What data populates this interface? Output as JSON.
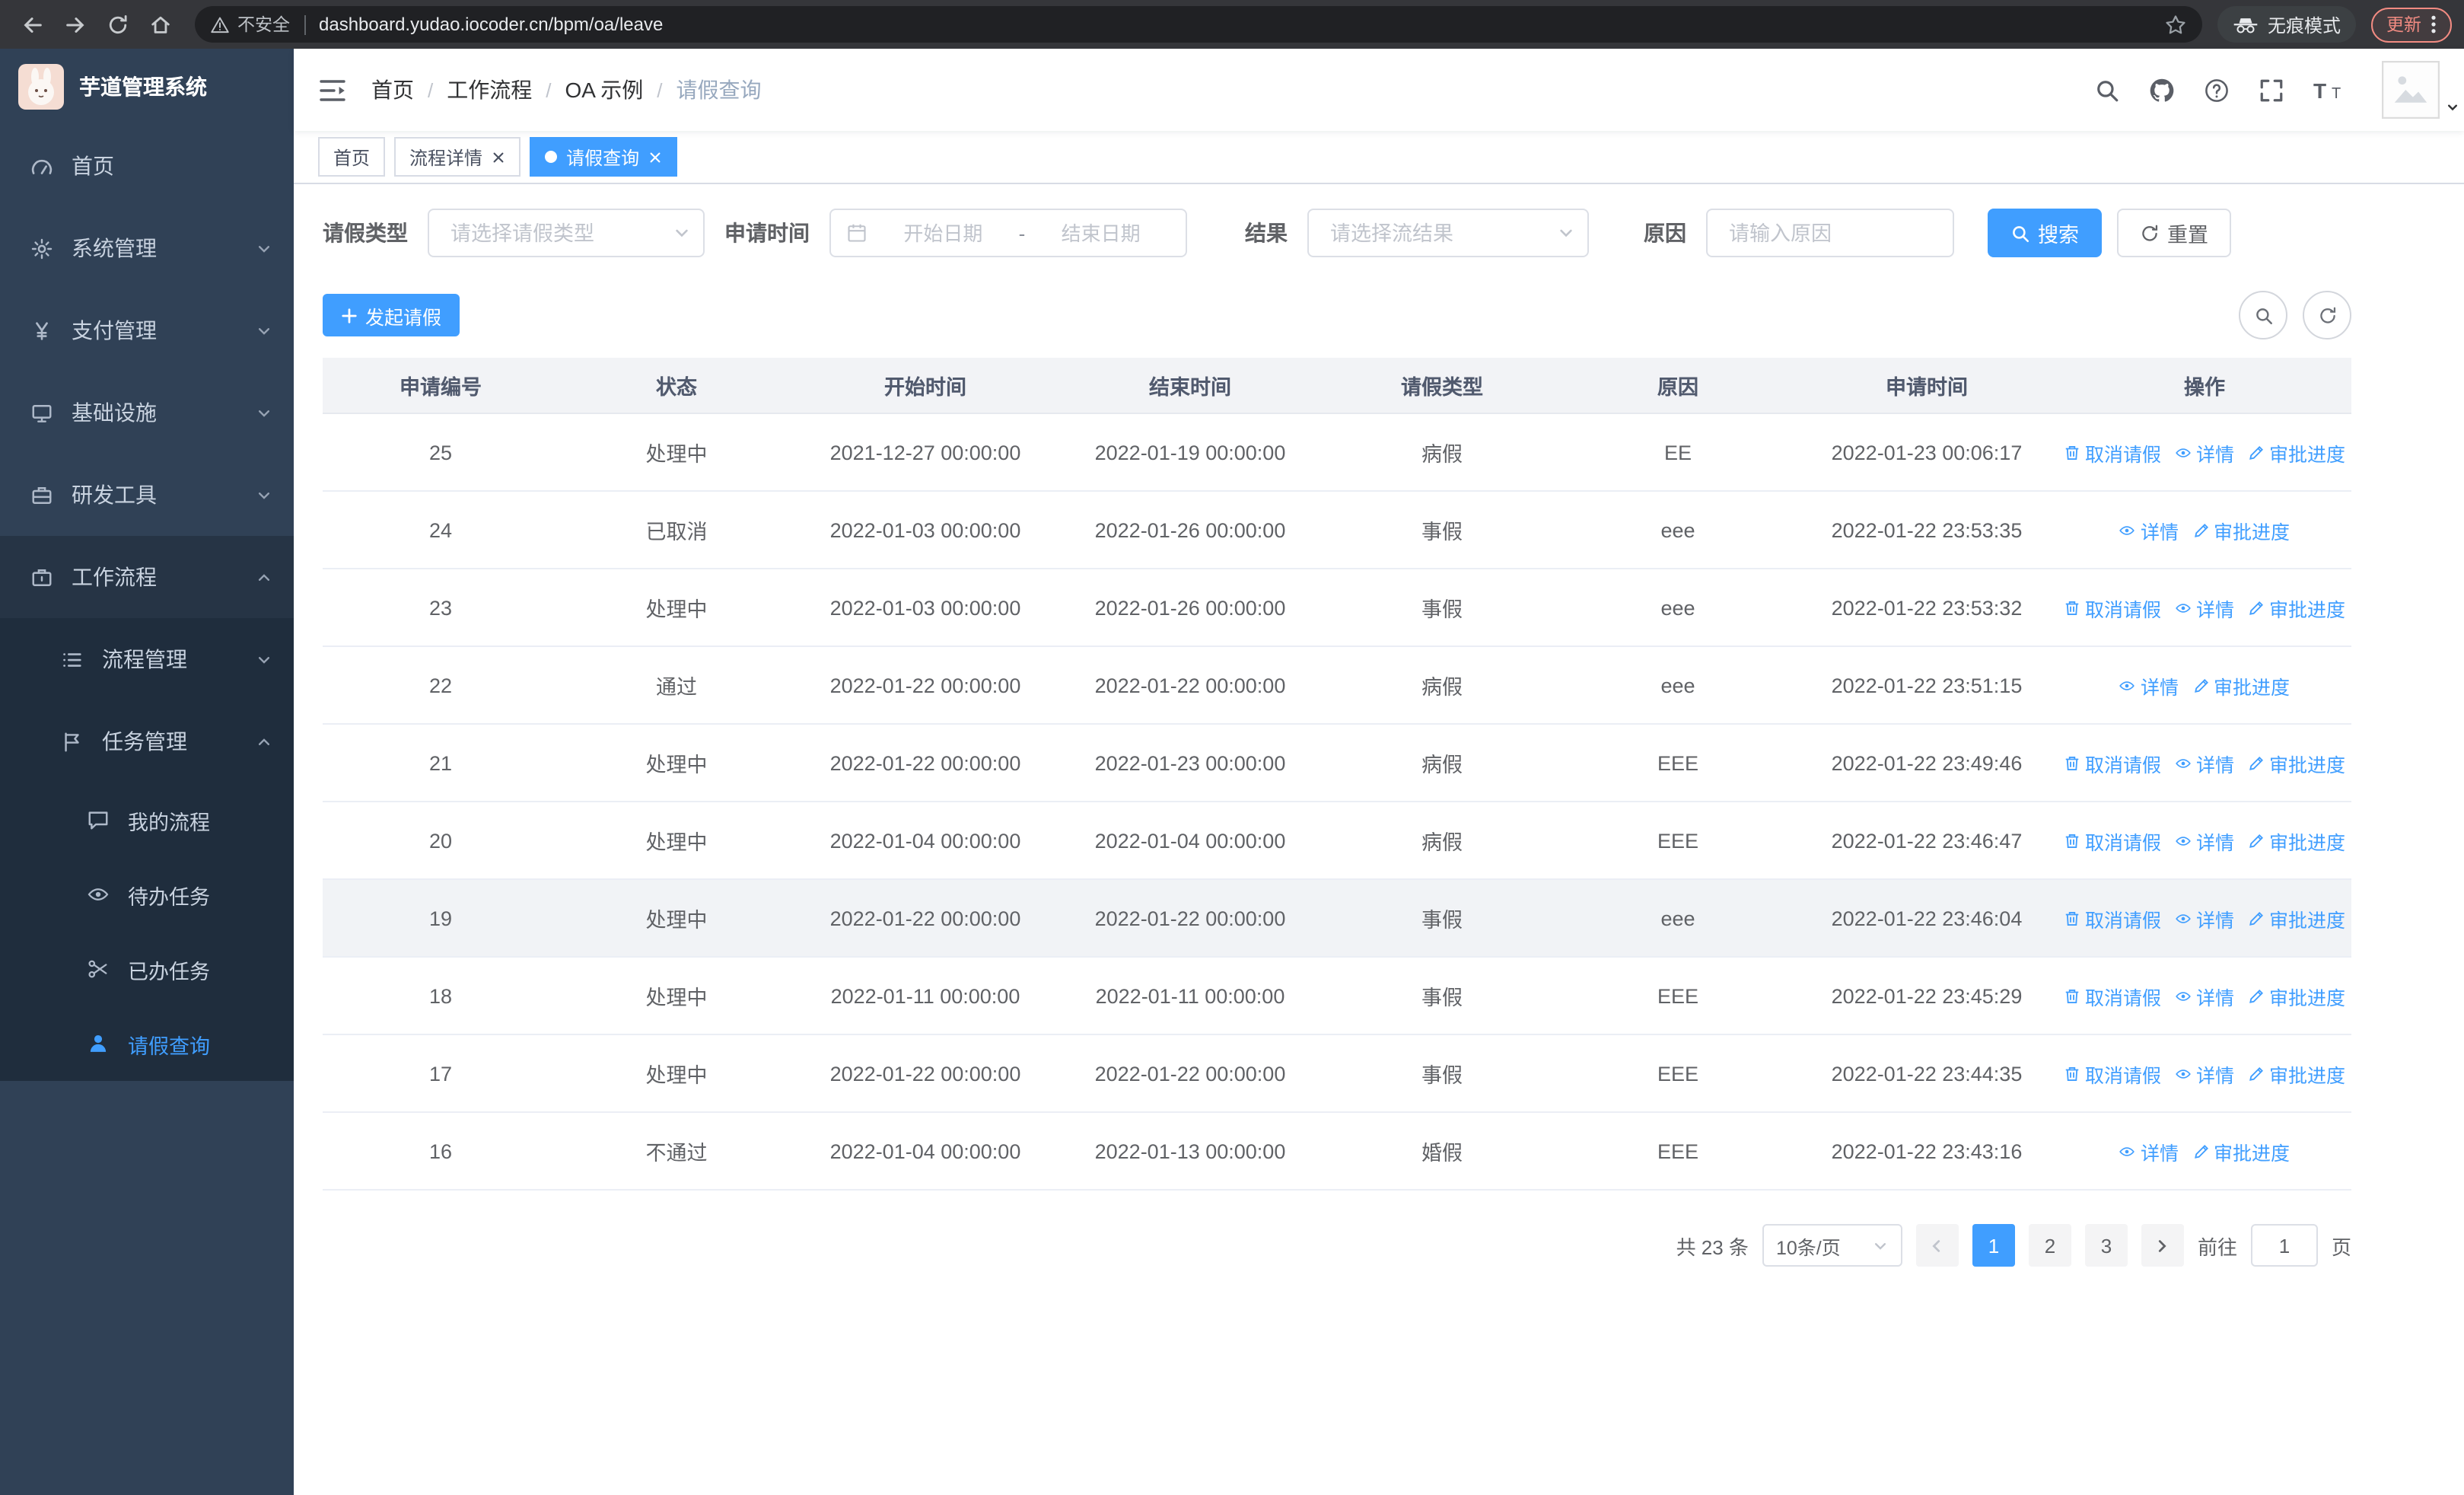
{
  "browser": {
    "warning": "不安全",
    "url": "dashboard.yudao.iocoder.cn/bpm/oa/leave",
    "incognito": "无痕模式",
    "update": "更新"
  },
  "sidebar": {
    "title": "芋道管理系统",
    "menu": [
      {
        "key": "home",
        "label": "首页",
        "icon": "dashboard",
        "level": 1
      },
      {
        "key": "system-mgmt",
        "label": "系统管理",
        "icon": "gear",
        "level": 1,
        "arrow": "down"
      },
      {
        "key": "payment-mgmt",
        "label": "支付管理",
        "icon": "yen",
        "level": 1,
        "arrow": "down"
      },
      {
        "key": "infrastructure",
        "label": "基础设施",
        "icon": "monitor",
        "level": 1,
        "arrow": "down"
      },
      {
        "key": "dev-tools",
        "label": "研发工具",
        "icon": "toolbox",
        "level": 1,
        "arrow": "down"
      },
      {
        "key": "workflow",
        "label": "工作流程",
        "icon": "briefcase",
        "level": 1,
        "arrow": "up",
        "open": true
      },
      {
        "key": "process-mgmt",
        "label": "流程管理",
        "icon": "list",
        "level": 2,
        "arrow": "down"
      },
      {
        "key": "task-mgmt",
        "label": "任务管理",
        "icon": "flag",
        "level": 2,
        "arrow": "up",
        "open": true
      },
      {
        "key": "my-process",
        "label": "我的流程",
        "icon": "chat",
        "level": 3
      },
      {
        "key": "todo-task",
        "label": "待办任务",
        "icon": "eye",
        "level": 3
      },
      {
        "key": "done-task",
        "label": "已办任务",
        "icon": "scissors",
        "level": 3
      },
      {
        "key": "leave-query",
        "label": "请假查询",
        "icon": "user",
        "level": 3,
        "active": true
      }
    ]
  },
  "navbar": {
    "breadcrumb": [
      "首页",
      "工作流程",
      "OA 示例",
      "请假查询"
    ],
    "breadcrumb_separator": "/"
  },
  "tabs": [
    {
      "key": "home",
      "label": "首页",
      "active": false,
      "closable": false
    },
    {
      "key": "process-detail",
      "label": "流程详情",
      "active": false,
      "closable": true
    },
    {
      "key": "leave-query",
      "label": "请假查询",
      "active": true,
      "closable": true
    }
  ],
  "filters": {
    "leave_type_label": "请假类型",
    "leave_type_placeholder": "请选择请假类型",
    "apply_time_label": "申请时间",
    "start_placeholder": "开始日期",
    "range_separator": "-",
    "end_placeholder": "结束日期",
    "result_label": "结果",
    "result_placeholder": "请选择流结果",
    "reason_label": "原因",
    "reason_placeholder": "请输入原因",
    "search": "搜索",
    "reset": "重置"
  },
  "toolbar": {
    "create": "发起请假"
  },
  "table": {
    "headers": [
      "申请编号",
      "状态",
      "开始时间",
      "结束时间",
      "请假类型",
      "原因",
      "申请时间",
      "操作"
    ],
    "action_labels": {
      "cancel": "取消请假",
      "detail": "详情",
      "progress": "审批进度"
    },
    "rows": [
      {
        "id": "25",
        "status": "处理中",
        "start": "2021-12-27 00:00:00",
        "end": "2022-01-19 00:00:00",
        "type": "病假",
        "reason": "EE",
        "applied": "2022-01-23 00:06:17",
        "actions": [
          "cancel",
          "detail",
          "progress"
        ]
      },
      {
        "id": "24",
        "status": "已取消",
        "start": "2022-01-03 00:00:00",
        "end": "2022-01-26 00:00:00",
        "type": "事假",
        "reason": "eee",
        "applied": "2022-01-22 23:53:35",
        "actions": [
          "detail",
          "progress"
        ]
      },
      {
        "id": "23",
        "status": "处理中",
        "start": "2022-01-03 00:00:00",
        "end": "2022-01-26 00:00:00",
        "type": "事假",
        "reason": "eee",
        "applied": "2022-01-22 23:53:32",
        "actions": [
          "cancel",
          "detail",
          "progress"
        ]
      },
      {
        "id": "22",
        "status": "通过",
        "start": "2022-01-22 00:00:00",
        "end": "2022-01-22 00:00:00",
        "type": "病假",
        "reason": "eee",
        "applied": "2022-01-22 23:51:15",
        "actions": [
          "detail",
          "progress"
        ]
      },
      {
        "id": "21",
        "status": "处理中",
        "start": "2022-01-22 00:00:00",
        "end": "2022-01-23 00:00:00",
        "type": "病假",
        "reason": "EEE",
        "applied": "2022-01-22 23:49:46",
        "actions": [
          "cancel",
          "detail",
          "progress"
        ]
      },
      {
        "id": "20",
        "status": "处理中",
        "start": "2022-01-04 00:00:00",
        "end": "2022-01-04 00:00:00",
        "type": "病假",
        "reason": "EEE",
        "applied": "2022-01-22 23:46:47",
        "actions": [
          "cancel",
          "detail",
          "progress"
        ]
      },
      {
        "id": "19",
        "status": "处理中",
        "start": "2022-01-22 00:00:00",
        "end": "2022-01-22 00:00:00",
        "type": "事假",
        "reason": "eee",
        "applied": "2022-01-22 23:46:04",
        "actions": [
          "cancel",
          "detail",
          "progress"
        ],
        "highlighted": true
      },
      {
        "id": "18",
        "status": "处理中",
        "start": "2022-01-11 00:00:00",
        "end": "2022-01-11 00:00:00",
        "type": "事假",
        "reason": "EEE",
        "applied": "2022-01-22 23:45:29",
        "actions": [
          "cancel",
          "detail",
          "progress"
        ]
      },
      {
        "id": "17",
        "status": "处理中",
        "start": "2022-01-22 00:00:00",
        "end": "2022-01-22 00:00:00",
        "type": "事假",
        "reason": "EEE",
        "applied": "2022-01-22 23:44:35",
        "actions": [
          "cancel",
          "detail",
          "progress"
        ]
      },
      {
        "id": "16",
        "status": "不通过",
        "start": "2022-01-04 00:00:00",
        "end": "2022-01-13 00:00:00",
        "type": "婚假",
        "reason": "EEE",
        "applied": "2022-01-22 23:43:16",
        "actions": [
          "detail",
          "progress"
        ]
      }
    ]
  },
  "pagination": {
    "total": "共 23 条",
    "page_size": "10条/页",
    "pages": [
      "1",
      "2",
      "3"
    ],
    "current": "1",
    "goto_prefix": "前往",
    "goto_value": "1",
    "goto_suffix": "页"
  },
  "colors": {
    "primary": "#409eff",
    "sidebar_bg": "#304156",
    "submenu_bg": "#1f2d3d"
  }
}
